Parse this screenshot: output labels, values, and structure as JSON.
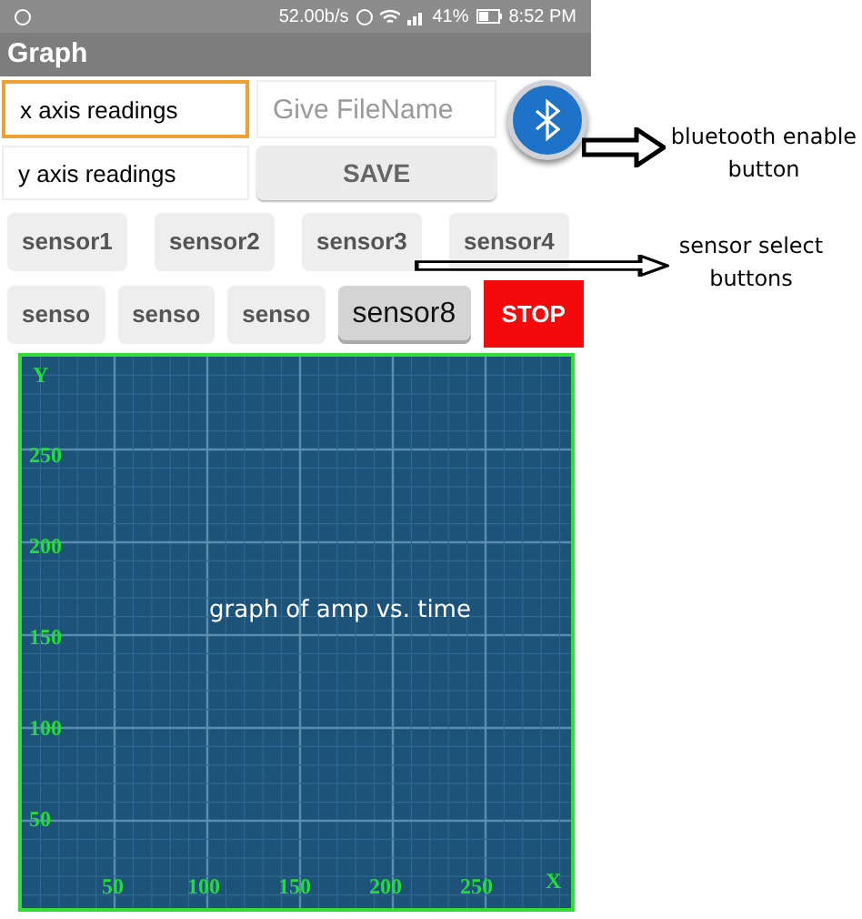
{
  "status_bar": {
    "speed": "52.00b/s",
    "battery": "41%",
    "time": "8:52 PM"
  },
  "title": "Graph",
  "x_field": {
    "value": "x axis readings",
    "focused": true
  },
  "filename_field": {
    "placeholder": "Give FileName"
  },
  "y_field": {
    "value": "y axis readings",
    "focused": false
  },
  "save_button": "SAVE",
  "sensors": [
    {
      "label": "sensor1",
      "selected": false
    },
    {
      "label": "sensor2",
      "selected": false
    },
    {
      "label": "sensor3",
      "selected": false
    },
    {
      "label": "sensor4",
      "selected": false
    },
    {
      "label": "senso",
      "selected": false
    },
    {
      "label": "senso",
      "selected": false
    },
    {
      "label": "senso",
      "selected": false
    },
    {
      "label": "sensor8",
      "selected": true
    }
  ],
  "stop_button": "STOP",
  "graph": {
    "y_axis_label": "Y",
    "x_axis_label": "X",
    "y_ticks": [
      "250",
      "200",
      "150",
      "100",
      "50"
    ],
    "x_ticks": [
      "50",
      "100",
      "150",
      "200",
      "250"
    ],
    "caption": "graph of amp vs. time"
  },
  "annotations": [
    {
      "text": "bluetooth enable button"
    },
    {
      "text": "sensor select buttons"
    }
  ]
}
